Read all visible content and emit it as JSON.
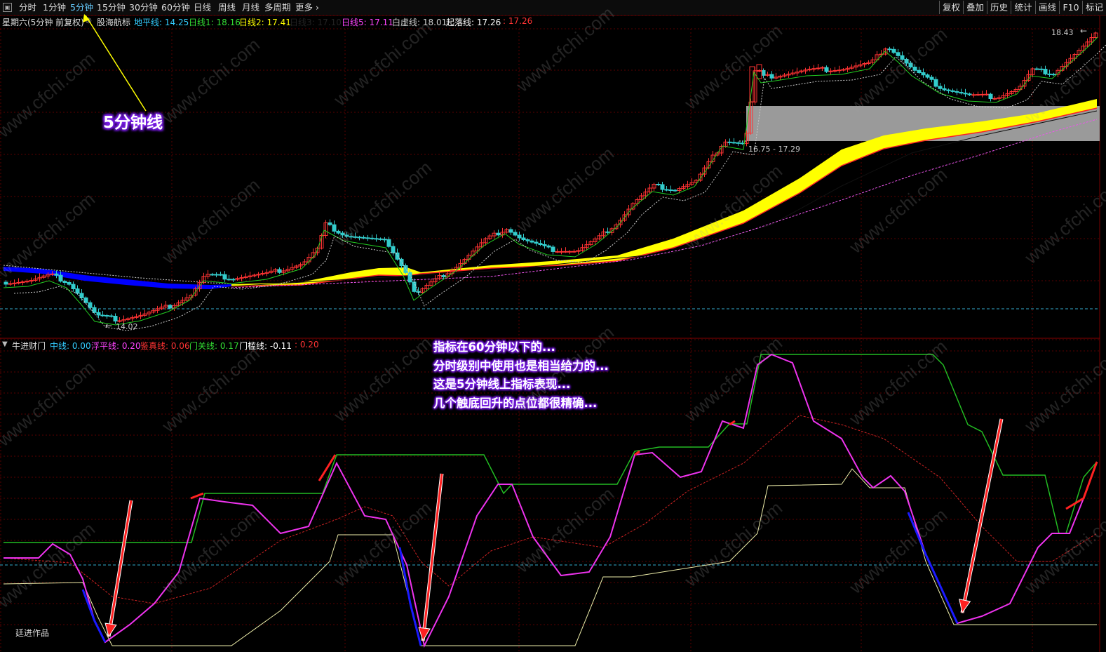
{
  "toolbar": {
    "menu_icon": "window-menu-icon",
    "periods": [
      "分时",
      "1分钟",
      "5分钟",
      "15分钟",
      "30分钟",
      "60分钟",
      "日线",
      "周线",
      "月线",
      "多周期",
      "更多"
    ],
    "active_period": "5分钟",
    "right_buttons": [
      "复权",
      "叠加",
      "历史",
      "统计",
      "画线",
      "F10",
      "标记"
    ]
  },
  "main_legend": {
    "title": "星期六(5分钟 前复权)",
    "indicator_name": "股海航标",
    "items": [
      {
        "label": "地平线: 14.25",
        "color": "#33ccff"
      },
      {
        "label": "日线1: 18.16",
        "color": "#33dd33"
      },
      {
        "label": "日线2: 17.41",
        "color": "#ffff00"
      },
      {
        "label": "日线3: 17.10",
        "color": "#222222"
      },
      {
        "label": "日线5: 17.11",
        "color": "#ff44ff"
      },
      {
        "label": "白虚线: 18.01",
        "color": "#cccccc"
      },
      {
        "label": "起落线: 17.26",
        "color": "#ffffff"
      },
      {
        "label": ": 17.26",
        "color": "#ff3333"
      }
    ]
  },
  "price_labels": {
    "high": "18.43",
    "low": "14.02",
    "band": "16.75 - 17.29"
  },
  "indicator_legend": {
    "name": "牛进财门",
    "items": [
      {
        "label": "中线: 0.00",
        "color": "#33ccff"
      },
      {
        "label": "浮平线: 0.20",
        "color": "#ff44ff"
      },
      {
        "label": "鉴真线: 0.06",
        "color": "#ff3333"
      },
      {
        "label": "门关线: 0.17",
        "color": "#33dd33"
      },
      {
        "label": "门槛线: -0.11",
        "color": "#ffffff"
      },
      {
        "label": ": 0.20",
        "color": "#ff3333"
      }
    ]
  },
  "annotations": {
    "period_callout": "5分钟线",
    "notes": [
      "指标在60分钟以下的...",
      "分时级别中使用也是相当给力的...",
      "这是5分钟线上指标表现...",
      "几个触底回升的点位都很精确..."
    ],
    "author": "廷进作品"
  },
  "watermark": "www.cfchi.com",
  "colors": {
    "up": "#ff3333",
    "down": "#33cccc",
    "grid": "#5a0000",
    "blue_band": "#0000ff",
    "yellow_band": "#ffff00",
    "gray_zone": "#9a9a9a",
    "magenta": "#ff44ff",
    "green": "#33cc33",
    "arrow": "#ff2020"
  }
}
